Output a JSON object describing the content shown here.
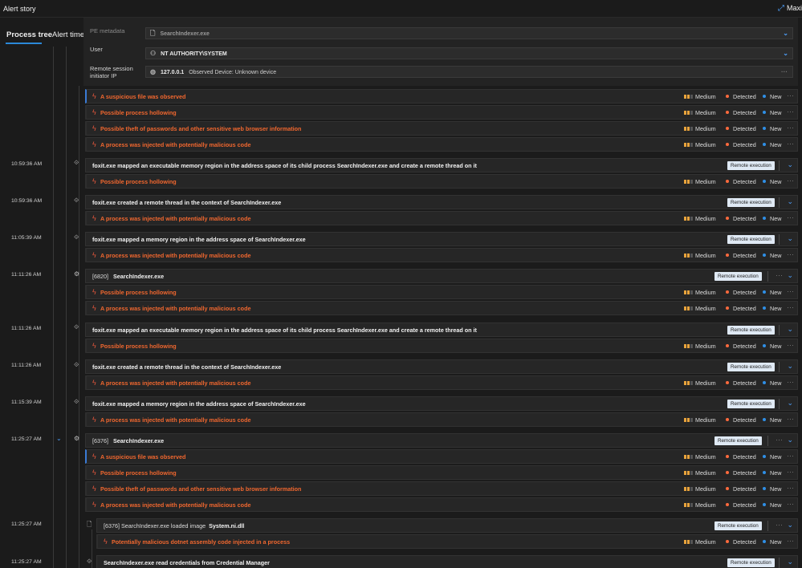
{
  "header": {
    "title": "Alert story",
    "maximize_label": "Maxi"
  },
  "tabs": [
    "Process tree",
    "Alert timeline"
  ],
  "metadata": {
    "pe_label": "PE metadata",
    "pe_value": "SearchIndexer.exe",
    "user_label": "User",
    "user_value": "NT AUTHORITY\\SYSTEM",
    "ip_label_1": "Remote session",
    "ip_label_2": "initiator IP",
    "ip_value": "127.0.0.1",
    "ip_device": "Observed Device: Unknown device"
  },
  "status": {
    "severity": "Medium",
    "detection": "Detected",
    "state": "New"
  },
  "colors": {
    "alert_text": "#f0672f",
    "accent_blue": "#2b88d8",
    "severity_fill": "#e8a33c"
  },
  "tag_label": "Remote execution",
  "alerts": {
    "a1": "A suspicious file was observed",
    "a2": "Possible process hollowing",
    "a3": "Possible theft of passwords and other sensitive web browser information",
    "a4": "A process was injected with potentially malicious code",
    "a5": "Possible process hollowing",
    "a6": "A process was injected with potentially malicious code",
    "a7": "A process was injected with potentially malicious code",
    "a8": "Possible process hollowing",
    "a9": "A process was injected with potentially malicious code",
    "a10": "Possible process hollowing",
    "a11": "A process was injected with potentially malicious code",
    "a12": "A process was injected with potentially malicious code",
    "a13": "A suspicious file was observed",
    "a14": "Possible process hollowing",
    "a15": "Possible theft of passwords and other sensitive web browser information",
    "a16": "A process was injected with potentially malicious code",
    "a17": "Potentially malicious dotnet assembly code injected in a process"
  },
  "events": {
    "e1": {
      "time": "10:59:36 AM",
      "text": "foxit.exe mapped an executable memory region in the address space of its child process SearchIndexer.exe and create a remote thread on it"
    },
    "e2": {
      "time": "10:59:36 AM",
      "text": "foxit.exe created a remote thread in the context of SearchIndexer.exe"
    },
    "e3": {
      "time": "11:05:39 AM",
      "text": "foxit.exe mapped a memory region in the address space of SearchIndexer.exe"
    },
    "e4": {
      "time": "11:11:26 AM",
      "pid": "[6820]",
      "name": "SearchIndexer.exe"
    },
    "e5": {
      "time": "11:11:26 AM",
      "text": "foxit.exe mapped an executable memory region in the address space of its child process SearchIndexer.exe and create a remote thread on it"
    },
    "e6": {
      "time": "11:11:26 AM",
      "text": "foxit.exe created a remote thread in the context of SearchIndexer.exe"
    },
    "e7": {
      "time": "11:15:39 AM",
      "text": "foxit.exe mapped a memory region in the address space of SearchIndexer.exe"
    },
    "e8": {
      "time": "11:25:27 AM",
      "pid": "[6376]",
      "name": "SearchIndexer.exe"
    },
    "e9": {
      "time": "11:25:27 AM",
      "text": "[6376] SearchIndexer.exe loaded image",
      "image": "System.ni.dll"
    },
    "e10": {
      "time": "11:25:27 AM",
      "text": "SearchIndexer.exe read credentials from Credential Manager"
    }
  }
}
